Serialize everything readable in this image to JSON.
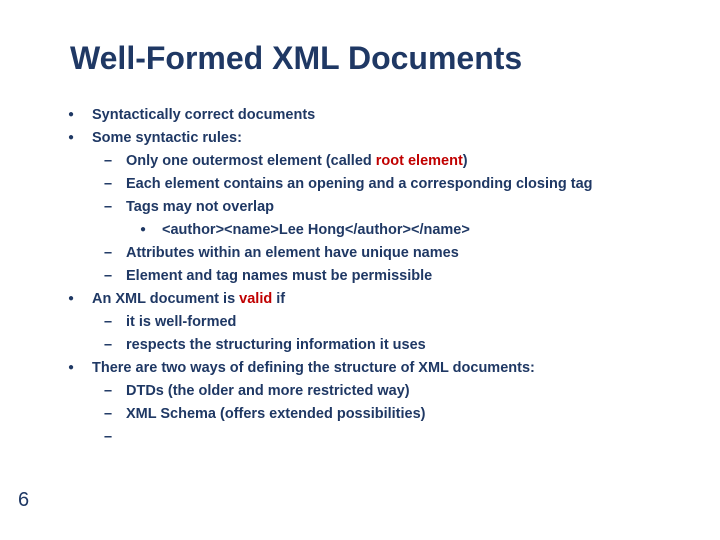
{
  "title": "Well-Formed XML Documents",
  "pageNumber": "6",
  "b1": "Syntactically correct documents",
  "b2": "Some syntactic rules:",
  "b2s1a": "Only one outermost element (called ",
  "b2s1_red": "root element",
  "b2s1b": ")",
  "b2s2": "Each element contains an opening and a corresponding closing tag",
  "b2s3": "Tags may not overlap",
  "b2s3x": "<author><name>Lee Hong</author></name>",
  "b2s4": "Attributes within an element have unique names",
  "b2s5": "Element and tag names must be permissible",
  "b3a": "An XML document is ",
  "b3_red": "valid",
  "b3b": " if",
  "b3s1": "it is well-formed",
  "b3s2": "respects the structuring information it uses",
  "b4": "There are two ways of defining the structure of XML documents:",
  "b4s1": "DTDs (the older and more restricted way)",
  "b4s2": "XML Schema (offers extended possibilities)"
}
